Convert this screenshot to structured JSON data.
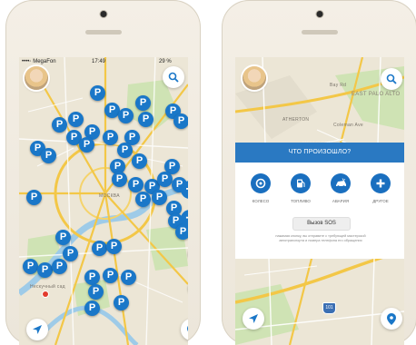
{
  "left_screen": {
    "status": {
      "carrier": "••••◦ MegaFon",
      "time": "17:49",
      "battery": "29 %"
    },
    "pin_label": "P",
    "zoom_in": "+",
    "zoom_out": "−",
    "map_labels": [
      "МОСКВА",
      "Нескучный сад"
    ],
    "icons": {
      "search": "search-icon",
      "locate": "navigation-arrow-icon",
      "place": "location-pin-icon"
    },
    "colors": {
      "pin": "#1a77c8",
      "road": "#f3c747",
      "water": "#9ecbe8",
      "park": "#cfe3b4"
    }
  },
  "right_screen": {
    "map_labels": [
      "ATHERTON",
      "MENLO PARK",
      "EAST PALO ALTO",
      "Bay Rd",
      "Coleman Ave"
    ],
    "panel": {
      "title": "ЧТО ПРОИЗОШЛО?",
      "options": [
        {
          "label": "КОЛЕСО",
          "icon": "wheel-icon"
        },
        {
          "label": "ТОПЛИВО",
          "icon": "fuel-icon"
        },
        {
          "label": "АВАРИЯ",
          "icon": "car-accident-icon"
        },
        {
          "label": "ДРУГОЕ",
          "icon": "plus-icon"
        }
      ],
      "sos_button": "Вызов SOS",
      "sos_note": "нажимая кнопку, вы отправите с требующей мастерской автотранспорта и номера телефона его обращения"
    },
    "icons": {
      "search": "search-icon",
      "locate": "navigation-arrow-icon",
      "place": "location-pin-icon"
    },
    "highway_shield": "101",
    "colors": {
      "panel_head": "#2a79c2",
      "option_icon": "#1a6fbf"
    }
  }
}
